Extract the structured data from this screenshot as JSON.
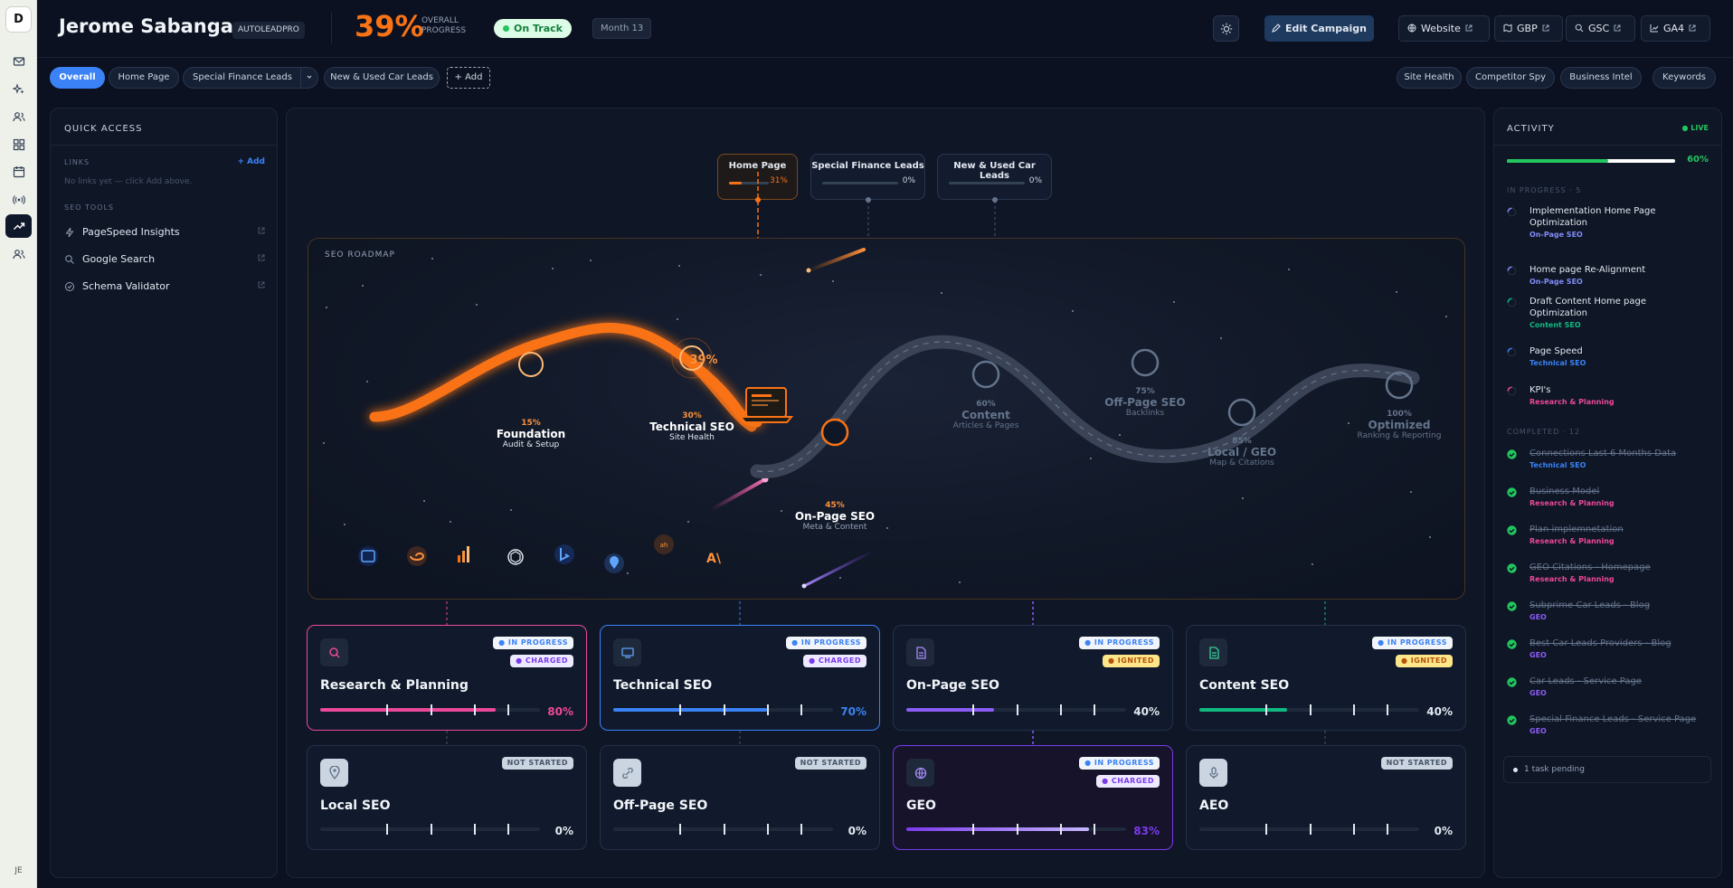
{
  "rail": {
    "logo": "D",
    "user_initials": "JE"
  },
  "header": {
    "client_name": "Jerome Sabangan",
    "account_tag": "AUTOLEADPRO",
    "progress_pct": "39%",
    "progress_label": "OVERALL PROGRESS",
    "status": "On Track",
    "month": "Month 13",
    "edit_label": "Edit Campaign",
    "links": [
      "Website",
      "GBP",
      "GSC",
      "GA4"
    ]
  },
  "tabs": {
    "pages": [
      "Overall",
      "Home Page",
      "Special Finance Leads",
      "New & Used Car Leads"
    ],
    "add_label": "+ Add",
    "tools": [
      "Site Health",
      "Competitor Spy",
      "Business Intel",
      "Keywords"
    ]
  },
  "quick_access": {
    "title": "QUICK ACCESS",
    "links_label": "LINKS",
    "add_label": "+ Add",
    "empty_text": "No links yet — click Add above.",
    "seo_tools_label": "SEO TOOLS",
    "tools": [
      "PageSpeed Insights",
      "Google Search",
      "Schema Validator"
    ]
  },
  "page_chips": [
    {
      "label": "Home Page",
      "value": "31%",
      "progress": 0.31
    },
    {
      "label": "Special Finance Leads",
      "value": "0%",
      "progress": 0
    },
    {
      "label": "New & Used Car Leads",
      "value": "0%",
      "progress": 0
    }
  ],
  "roadmap": {
    "label": "SEO ROADMAP",
    "current_pct": "39%",
    "milestones": [
      {
        "pct": "15%",
        "title": "Foundation",
        "sub": "Audit & Setup"
      },
      {
        "pct": "30%",
        "title": "Technical SEO",
        "sub": "Site Health"
      },
      {
        "pct": "45%",
        "title": "On-Page SEO",
        "sub": "Meta & Content"
      },
      {
        "pct": "60%",
        "title": "Content",
        "sub": "Articles & Pages"
      },
      {
        "pct": "75%",
        "title": "Off-Page SEO",
        "sub": "Backlinks"
      },
      {
        "pct": "85%",
        "title": "Local / GEO",
        "sub": "Map & Citations"
      },
      {
        "pct": "100%",
        "title": "Optimized",
        "sub": "Ranking & Reporting"
      }
    ],
    "engine_icons": [
      "ahrefs-icon",
      "semrush-icon",
      "analytics-icon",
      "openai-icon",
      "bing-icon",
      "maps-icon",
      "ahrefs-mark-icon",
      "anthropic-icon"
    ],
    "engine_texts": {
      "ahrefs": "ah",
      "anthropic": "A\\"
    }
  },
  "cards": [
    {
      "title": "Research & Planning",
      "status": "IN PROGRESS",
      "charge": "CHARGED",
      "value": "80%",
      "progress": 0.8,
      "accent": "#ec4899"
    },
    {
      "title": "Technical SEO",
      "status": "IN PROGRESS",
      "charge": "CHARGED",
      "value": "70%",
      "progress": 0.7,
      "accent": "#3b82f6"
    },
    {
      "title": "On-Page SEO",
      "status": "IN PROGRESS",
      "charge": "IGNITED",
      "value": "40%",
      "progress": 0.4,
      "accent": "#8b5cf6"
    },
    {
      "title": "Content SEO",
      "status": "IN PROGRESS",
      "charge": "IGNITED",
      "value": "40%",
      "progress": 0.4,
      "accent": "#10b981"
    },
    {
      "title": "Local SEO",
      "status": "NOT STARTED",
      "charge": "",
      "value": "0%",
      "progress": 0,
      "accent": "#64748b"
    },
    {
      "title": "Off-Page SEO",
      "status": "NOT STARTED",
      "charge": "",
      "value": "0%",
      "progress": 0,
      "accent": "#64748b"
    },
    {
      "title": "GEO",
      "status": "IN PROGRESS",
      "charge": "CHARGED",
      "value": "83%",
      "progress": 0.83,
      "accent": "#7c3aed"
    },
    {
      "title": "AEO",
      "status": "NOT STARTED",
      "charge": "",
      "value": "0%",
      "progress": 0,
      "accent": "#64748b"
    }
  ],
  "activity": {
    "title": "ACTIVITY",
    "live": "LIVE",
    "progress_value": "60%",
    "progress": 0.6,
    "in_progress_label": "IN PROGRESS · 5",
    "in_progress": [
      {
        "task": "Implementation Home Page Optimization",
        "tag": "On-Page SEO",
        "color": "#818cf8"
      },
      {
        "task": "Home page Re-Alignment",
        "tag": "On-Page SEO",
        "color": "#818cf8"
      },
      {
        "task": "Draft Content Home page Optimization",
        "tag": "Content SEO",
        "color": "#10b981"
      },
      {
        "task": "Page Speed",
        "tag": "Technical SEO",
        "color": "#3b82f6"
      },
      {
        "task": "KPI's",
        "tag": "Research & Planning",
        "color": "#ec4899"
      }
    ],
    "completed_label": "COMPLETED · 12",
    "completed": [
      {
        "task": "Connections Last 6 Months Data",
        "tag": "Technical SEO",
        "color": "#3b82f6"
      },
      {
        "task": "Business Model",
        "tag": "Research & Planning",
        "color": "#ec4899"
      },
      {
        "task": "Plan implemnetation",
        "tag": "Research & Planning",
        "color": "#ec4899"
      },
      {
        "task": "GEO Citations - Homepage",
        "tag": "Research & Planning",
        "color": "#ec4899"
      },
      {
        "task": "Subprime Car Leads - Blog",
        "tag": "GEO",
        "color": "#8b5cf6"
      },
      {
        "task": "Best Car Leads Providers - Blog",
        "tag": "GEO",
        "color": "#8b5cf6"
      },
      {
        "task": "Car Leads - Service Page",
        "tag": "GEO",
        "color": "#8b5cf6"
      },
      {
        "task": "Special Finance Leads - Service Page",
        "tag": "GEO",
        "color": "#8b5cf6"
      }
    ],
    "pending": "1 task pending"
  }
}
